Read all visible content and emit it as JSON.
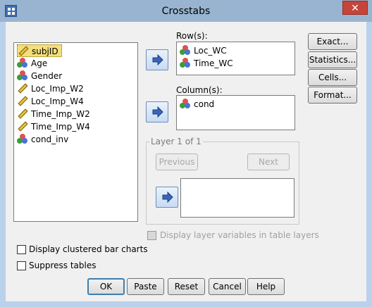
{
  "window": {
    "title": "Crosstabs",
    "close_glyph": "✕"
  },
  "source_list": {
    "items": [
      {
        "label": "subjID",
        "icon": "ruler-icon",
        "selected": true
      },
      {
        "label": "Age",
        "icon": "nominal-icon",
        "selected": false
      },
      {
        "label": "Gender",
        "icon": "nominal-icon",
        "selected": false
      },
      {
        "label": "Loc_Imp_W2",
        "icon": "ruler-icon",
        "selected": false
      },
      {
        "label": "Loc_Imp_W4",
        "icon": "ruler-icon",
        "selected": false
      },
      {
        "label": "Time_Imp_W2",
        "icon": "ruler-icon",
        "selected": false
      },
      {
        "label": "Time_Imp_W4",
        "icon": "ruler-icon",
        "selected": false
      },
      {
        "label": "cond_inv",
        "icon": "nominal-icon",
        "selected": false
      }
    ]
  },
  "rows": {
    "label": "Row(s):",
    "items": [
      "Loc_WC",
      "Time_WC"
    ]
  },
  "columns": {
    "label": "Column(s):",
    "items": [
      "cond"
    ]
  },
  "layer": {
    "title": "Layer 1 of 1",
    "previous_label": "Previous",
    "next_label": "Next"
  },
  "side_buttons": {
    "exact": "Exact...",
    "statistics": "Statistics...",
    "cells": "Cells...",
    "format": "Format..."
  },
  "options": {
    "display_layer": "Display layer variables in table layers",
    "clustered_bar": "Display clustered bar charts",
    "suppress_tables": "Suppress tables"
  },
  "footer": {
    "ok": "OK",
    "paste": "Paste",
    "reset": "Reset",
    "cancel": "Cancel",
    "help": "Help"
  },
  "colors": {
    "selection": "#f3df7c",
    "title_bar": "#99b4d1",
    "close": "#c7443b"
  }
}
